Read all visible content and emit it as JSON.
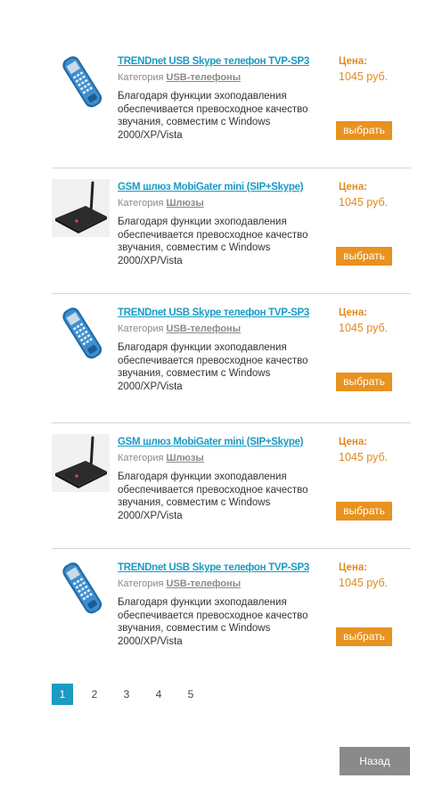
{
  "products": [
    {
      "title": "TRENDnet USB Skype телефон TVP-SP3",
      "category_label": "Категория",
      "category": "USB-телефоны",
      "description": "Благодаря функции эхоподавления обеспечивается превосходное качество звучания, совместим с Windows 2000/XP/Vista",
      "price_label": "Цена:",
      "price": "1045 руб.",
      "button": "выбрать",
      "image": "usb-phone-image"
    },
    {
      "title": "GSM шлюз MobiGater mini (SIP+Skype)",
      "category_label": "Категория",
      "category": "Шлюзы",
      "description": "Благодаря функции эхоподавления обеспечивается превосходное качество звучания, совместим с Windows 2000/XP/Vista",
      "price_label": "Цена:",
      "price": "1045 руб.",
      "button": "выбрать",
      "image": "gsm-gateway-image"
    },
    {
      "title": "TRENDnet USB Skype телефон TVP-SP3",
      "category_label": "Категория",
      "category": "USB-телефоны",
      "description": "Благодаря функции эхоподавления обеспечивается превосходное качество звучания, совместим с Windows 2000/XP/Vista",
      "price_label": "Цена:",
      "price": "1045 руб.",
      "button": "выбрать",
      "image": "usb-phone-image"
    },
    {
      "title": "GSM шлюз MobiGater mini (SIP+Skype)",
      "category_label": "Категория",
      "category": "Шлюзы",
      "description": "Благодаря функции эхоподавления обеспечивается превосходное качество звучания, совместим с Windows 2000/XP/Vista",
      "price_label": "Цена:",
      "price": "1045 руб.",
      "button": "выбрать",
      "image": "gsm-gateway-image"
    },
    {
      "title": "TRENDnet USB Skype телефон TVP-SP3",
      "category_label": "Категория",
      "category": "USB-телефоны",
      "description": "Благодаря функции эхоподавления обеспечивается превосходное качество звучания, совместим с Windows 2000/XP/Vista",
      "price_label": "Цена:",
      "price": "1045 руб.",
      "button": "выбрать",
      "image": "usb-phone-image"
    }
  ],
  "pagination": {
    "pages": [
      "1",
      "2",
      "3",
      "4",
      "5"
    ],
    "current": "1"
  },
  "back_button": "Назад",
  "colors": {
    "link": "#1a9bc4",
    "price": "#e08a1e",
    "button": "#e8921f",
    "back": "#8a8a8a"
  }
}
